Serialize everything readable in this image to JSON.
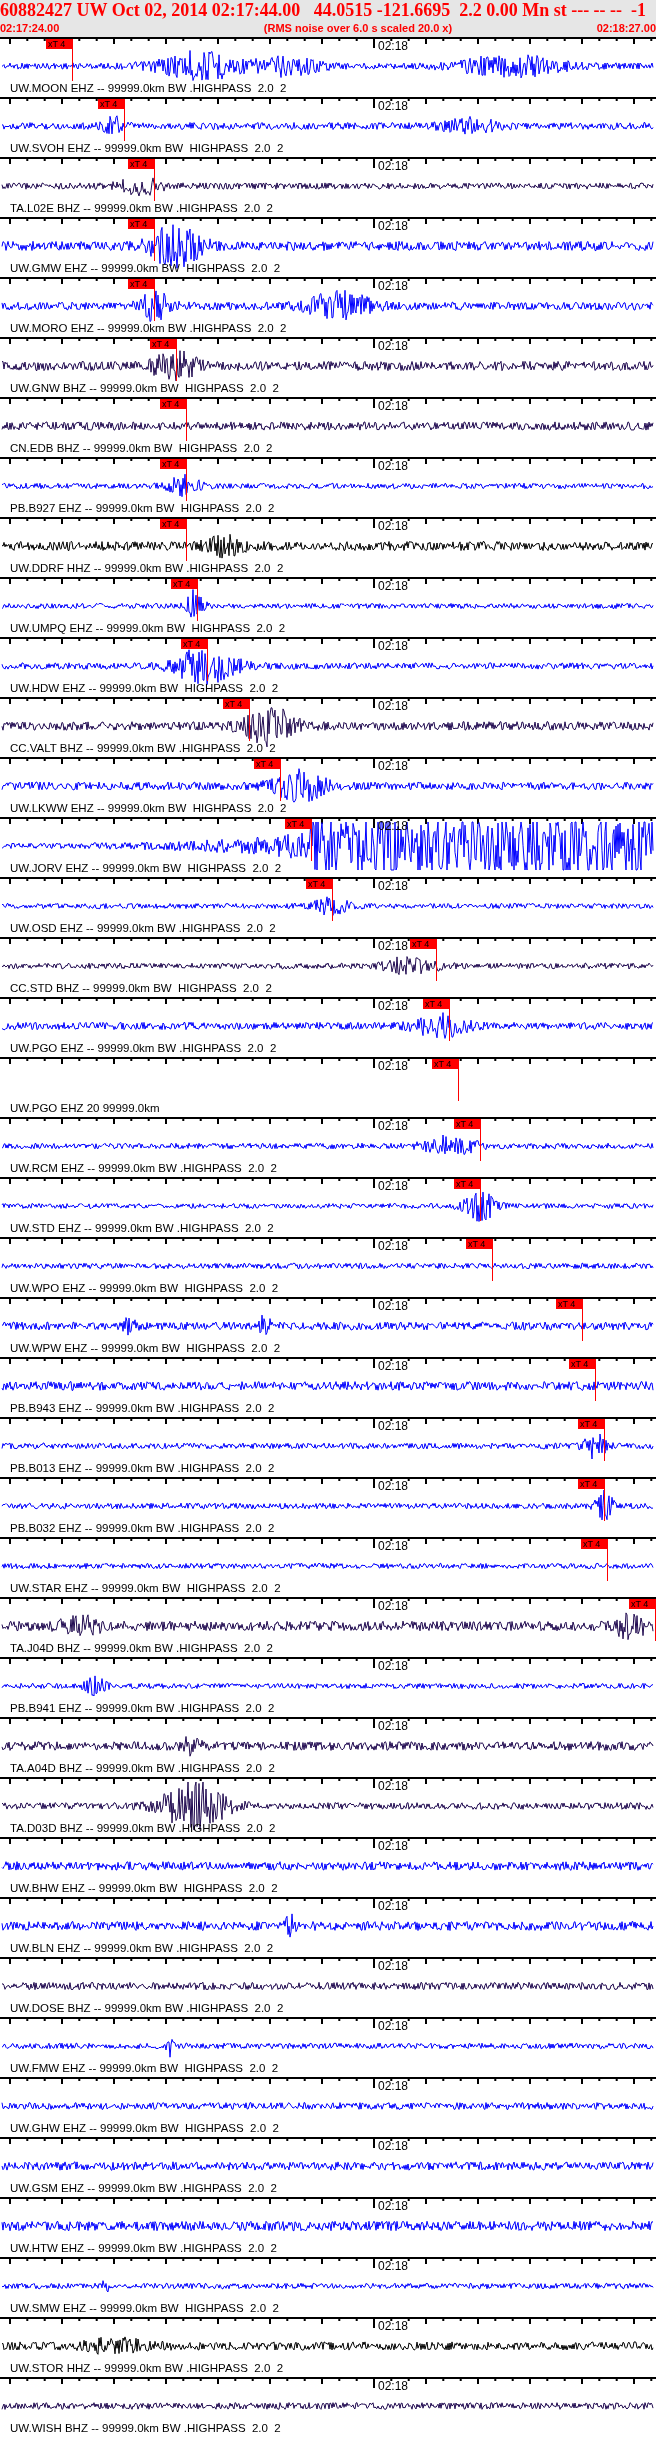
{
  "header": {
    "title": "60882427 UW Oct 02, 2014 02:17:44.00   44.0515 -121.6695  2.2 0.00 Mn st --- -- --  -1",
    "start_time": "02:17:24.00",
    "note": "(RMS noise over 6.0 s scaled 20.0 x)",
    "end_time": "02:18:27.00"
  },
  "traces": [
    {
      "label": "UW.MOON EHZ -- 99999.0km BW .HIGHPASS  2.0  2",
      "time_mark": "02:18",
      "kind": "shortperiod",
      "signal": true,
      "pick": "xT 4"
    },
    {
      "label": "UW.SVOH EHZ -- 99999.0km BW  HIGHPASS  2.0  2",
      "time_mark": "02:18",
      "kind": "shortperiod",
      "signal": true,
      "pick": "xT 4"
    },
    {
      "label": "TA.L02E BHZ -- 99999.0km BW .HIGHPASS  2.0  2",
      "time_mark": "02:18",
      "kind": "broadband",
      "signal": true,
      "pick": "xT 4"
    },
    {
      "label": "UW.GMW EHZ -- 99999.0km BW  HIGHPASS  2.0  2",
      "time_mark": "02:18",
      "kind": "shortperiod",
      "signal": true,
      "pick": "xT 4"
    },
    {
      "label": "UW.MORO EHZ -- 99999.0km BW .HIGHPASS  2.0  2",
      "time_mark": "02:18",
      "kind": "shortperiod",
      "signal": true,
      "pick": "xT 4"
    },
    {
      "label": "UW.GNW BHZ -- 99999.0km BW  HIGHPASS  2.0  2",
      "time_mark": "02:18",
      "kind": "broadband",
      "signal": true,
      "pick": "xT 4"
    },
    {
      "label": "CN.EDB BHZ -- 99999.0km BW  HIGHPASS  2.0  2",
      "time_mark": "02:18",
      "kind": "broadband",
      "signal": true,
      "pick": "xT 4"
    },
    {
      "label": "PB.B927 EHZ -- 99999.0km BW  HIGHPASS  2.0  2",
      "time_mark": "02:18",
      "kind": "shortperiod",
      "signal": true,
      "pick": "xT 4"
    },
    {
      "label": "UW.DDRF HHZ -- 99999.0km BW .HIGHPASS  2.0  2",
      "time_mark": "02:18",
      "kind": "highrate",
      "signal": true,
      "pick": "xT 4"
    },
    {
      "label": "UW.UMPQ EHZ -- 99999.0km BW  HIGHPASS  2.0  2",
      "time_mark": "02:18",
      "kind": "shortperiod",
      "signal": true,
      "pick": "xT 4"
    },
    {
      "label": "UW.HDW EHZ -- 99999.0km BW  HIGHPASS  2.0  2",
      "time_mark": "02:18",
      "kind": "shortperiod",
      "signal": true,
      "pick": "xT 4"
    },
    {
      "label": "CC.VALT BHZ -- 99999.0km BW .HIGHPASS  2.0  2",
      "time_mark": "02:18",
      "kind": "broadband",
      "signal": true,
      "pick": "xT 4"
    },
    {
      "label": "UW.LKWW EHZ -- 99999.0km BW  HIGHPASS  2.0  2",
      "time_mark": "02:18",
      "kind": "shortperiod",
      "signal": true,
      "pick": "xT 4"
    },
    {
      "label": "UW.JORV EHZ -- 99999.0km BW  HIGHPASS  2.0  2",
      "time_mark": "02:18",
      "kind": "shortperiod",
      "signal": true,
      "pick": "xT 4"
    },
    {
      "label": "UW.OSD EHZ -- 99999.0km BW .HIGHPASS  2.0  2",
      "time_mark": "02:18",
      "kind": "shortperiod",
      "signal": true,
      "pick": "xT 4"
    },
    {
      "label": "CC.STD BHZ -- 99999.0km BW  HIGHPASS  2.0  2",
      "time_mark": "02:18",
      "kind": "broadband",
      "signal": true,
      "pick": "xT 4"
    },
    {
      "label": "UW.PGO EHZ -- 99999.0km BW .HIGHPASS  2.0  2",
      "time_mark": "02:18",
      "kind": "shortperiod",
      "signal": true,
      "pick": "xT 4"
    },
    {
      "label": "UW.PGO EHZ 20 99999.0km",
      "time_mark": "02:18",
      "signal": false,
      "pick": "xT 4"
    },
    {
      "label": "UW.RCM EHZ -- 99999.0km BW .HIGHPASS  2.0  2",
      "time_mark": "02:18",
      "kind": "shortperiod",
      "signal": true,
      "pick": "xT 4"
    },
    {
      "label": "UW.STD EHZ -- 99999.0km BW .HIGHPASS  2.0  2",
      "time_mark": "02:18",
      "kind": "shortperiod",
      "signal": true,
      "pick": "xT 4"
    },
    {
      "label": "UW.WPO EHZ -- 99999.0km BW  HIGHPASS  2.0  2",
      "time_mark": "02:18",
      "kind": "shortperiod",
      "signal": true,
      "pick": "xT 4"
    },
    {
      "label": "UW.WPW EHZ -- 99999.0km BW  HIGHPASS  2.0  2",
      "time_mark": "02:18",
      "kind": "shortperiod",
      "signal": true,
      "pick": "xT 4"
    },
    {
      "label": "PB.B943 EHZ -- 99999.0km BW .HIGHPASS  2.0  2",
      "time_mark": "02:18",
      "kind": "shortperiod",
      "signal": true,
      "pick": "xT 4"
    },
    {
      "label": "PB.B013 EHZ -- 99999.0km BW .HIGHPASS  2.0  2",
      "time_mark": "02:18",
      "kind": "shortperiod",
      "signal": true,
      "pick": "xT 4"
    },
    {
      "label": "PB.B032 EHZ -- 99999.0km BW .HIGHPASS  2.0  2",
      "time_mark": "02:18",
      "kind": "shortperiod",
      "signal": true,
      "pick": "xT 4"
    },
    {
      "label": "UW.STAR EHZ -- 99999.0km BW  HIGHPASS  2.0  2",
      "time_mark": "02:18",
      "kind": "shortperiod",
      "signal": true,
      "pick": "xT 4"
    },
    {
      "label": "TA.J04D BHZ -- 99999.0km BW .HIGHPASS  2.0  2",
      "time_mark": "02:18",
      "kind": "broadband",
      "signal": true,
      "pick": "xT 4"
    },
    {
      "label": "PB.B941 EHZ -- 99999.0km BW .HIGHPASS  2.0  2",
      "time_mark": "02:18",
      "kind": "shortperiod",
      "signal": true
    },
    {
      "label": "TA.A04D BHZ -- 99999.0km BW .HIGHPASS  2.0  2",
      "time_mark": "02:18",
      "kind": "broadband",
      "signal": true
    },
    {
      "label": "TA.D03D BHZ -- 99999.0km BW .HIGHPASS  2.0  2",
      "time_mark": "02:18",
      "kind": "broadband",
      "signal": true
    },
    {
      "label": "UW.BHW EHZ -- 99999.0km BW  HIGHPASS  2.0  2",
      "time_mark": "02:18",
      "kind": "shortperiod",
      "signal": true
    },
    {
      "label": "UW.BLN EHZ -- 99999.0km BW .HIGHPASS  2.0  2",
      "time_mark": "02:18",
      "kind": "shortperiod",
      "signal": true
    },
    {
      "label": "UW.DOSE BHZ -- 99999.0km BW .HIGHPASS  2.0  2",
      "time_mark": "02:18",
      "kind": "broadband",
      "signal": true
    },
    {
      "label": "UW.FMW EHZ -- 99999.0km BW  HIGHPASS  2.0  2",
      "time_mark": "02:18",
      "kind": "shortperiod",
      "signal": true
    },
    {
      "label": "UW.GHW EHZ -- 99999.0km BW  HIGHPASS  2.0  2",
      "time_mark": "02:18",
      "kind": "shortperiod",
      "signal": true
    },
    {
      "label": "UW.GSM EHZ -- 99999.0km BW .HIGHPASS  2.0  2",
      "time_mark": "02:18",
      "kind": "shortperiod",
      "signal": true
    },
    {
      "label": "UW.HTW EHZ -- 99999.0km BW .HIGHPASS  2.0  2",
      "time_mark": "02:18",
      "kind": "shortperiod",
      "signal": true
    },
    {
      "label": "UW.SMW EHZ -- 99999.0km BW  HIGHPASS  2.0  2",
      "time_mark": "02:18",
      "kind": "shortperiod",
      "signal": true
    },
    {
      "label": "UW.STOR HHZ -- 99999.0km BW .HIGHPASS  2.0  2",
      "time_mark": "02:18",
      "kind": "highrate",
      "signal": true
    },
    {
      "label": "UW.WISH BHZ -- 99999.0km BW .HIGHPASS  2.0  2",
      "time_mark": "02:18",
      "kind": "broadband",
      "signal": true
    }
  ]
}
